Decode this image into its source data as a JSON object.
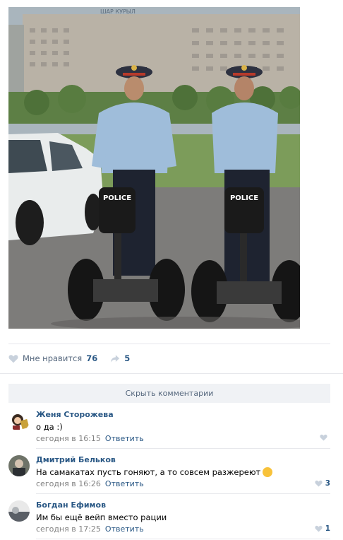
{
  "post": {
    "likes": {
      "label": "Мне нравится",
      "count": "76"
    },
    "shares": {
      "count": "5"
    }
  },
  "comments_toggle": "Скрыть комментарии",
  "comments": [
    {
      "author": "Женя Сторожева",
      "text": "о да :)",
      "time": "сегодня в 16:15",
      "reply": "Ответить",
      "likes": ""
    },
    {
      "author": "Дмитрий Бельков",
      "text": "На самакатах пусть гоняют, а то совсем разжереют",
      "time": "сегодня в 16:26",
      "reply": "Ответить",
      "likes": "3"
    },
    {
      "author": "Богдан Ефимов",
      "text": "Им бы ещё вейп вместо рации",
      "time": "сегодня в 17:25",
      "reply": "Ответить",
      "likes": "1"
    }
  ],
  "photo": {
    "badge_left": "POLICE",
    "badge_right": "POLICE",
    "building_sign": "ШАР КУРЫЛ"
  },
  "colors": {
    "link": "#2a5885",
    "muted": "#828282",
    "bar": "#f0f2f5"
  }
}
